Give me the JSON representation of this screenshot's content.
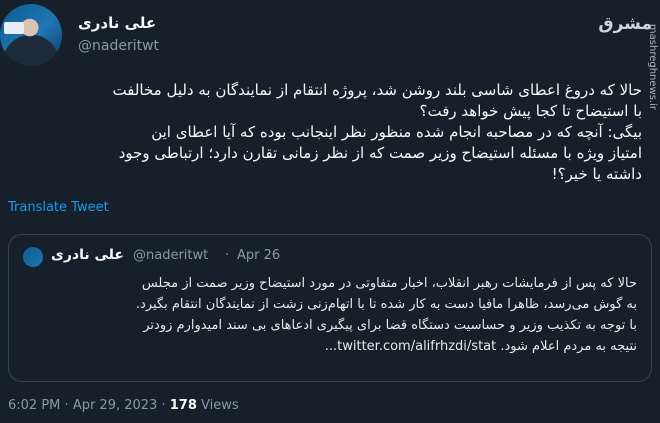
{
  "tweet": {
    "author_name": "علی نادری",
    "author_handle": "@naderitwt",
    "text": "حالا که دروغ اعطای شاسی بلند روشن شد، پروژه انتقام از نمایندگان به دلیل مخالفت\nبا استیضاح تا کجا پیش خواهد رفت؟\nبیگی: آنچه که در مصاحبه انجام شده منظور نظر اینجانب بوده که آیا اعطای این\nامتیاز ویژه با مسئله استیضاح وزیر صمت که از نظر زمانی تقارن دارد؛ ارتباطی وجود\nداشته یا خیر؟!",
    "translate_label": "Translate Tweet",
    "time": "6:02 PM",
    "date": "Apr 29, 2023",
    "separator": "·",
    "views_count": "178",
    "views_label": "Views"
  },
  "quoted": {
    "author_name": "علی نادری",
    "author_handle": "@naderitwt",
    "separator": "·",
    "date": "Apr 26",
    "text": "حالا که پس از فرمایشات رهبر انقلاب، اخبار متفاوتی در مورد استیضاح وزیر صمت از مجلس\nبه گوش می‌رسد، ظاهرا مافیا دست به کار شده تا با اتهام‌زنی زشت از نمایندگان انتقام بگیرد.\nبا توجه به تکذیب وزیر و حساسیت دستگاه قضا برای پیگیری ادعاهای بی سند امیدوارم زودتر\nنتیجه به مردم اعلام شود. twitter.com/alifrhzdi/stat..."
  },
  "watermark": {
    "logo": "مشرق",
    "url": "mashreghnews.ir"
  },
  "colors": {
    "background": "#15202b",
    "link": "#1d9bf0",
    "muted": "#8b98a5",
    "border": "#38444d"
  }
}
